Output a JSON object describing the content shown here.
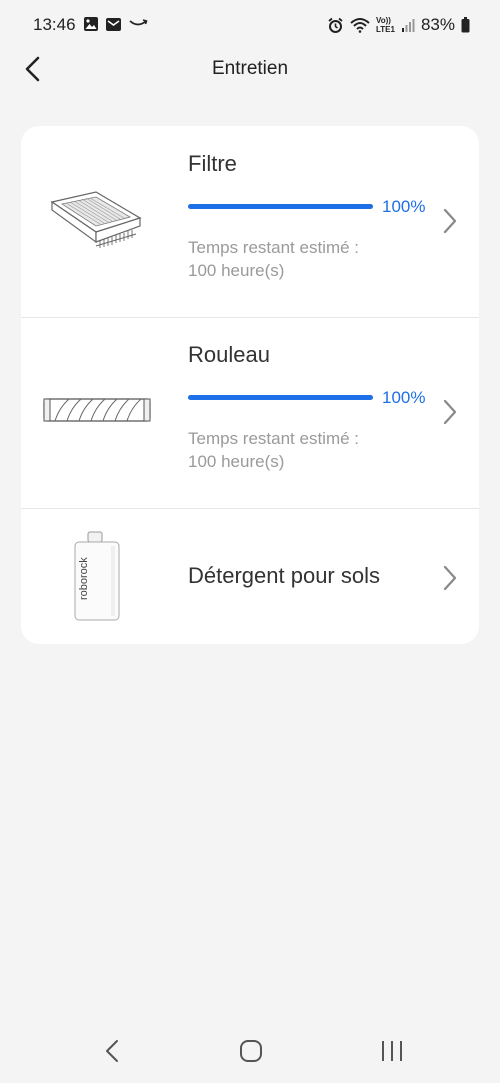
{
  "status_bar": {
    "time": "13:46",
    "battery": "83%",
    "left_icons": [
      "gallery-icon",
      "mail-icon",
      "amazon-icon"
    ],
    "right_icons": [
      "alarm-icon",
      "wifi-icon",
      "volte-icon",
      "signal-icon",
      "battery-icon"
    ],
    "volte_label_top": "Vo))",
    "volte_label_bottom": "LTE1"
  },
  "header": {
    "title": "Entretien"
  },
  "items": [
    {
      "name": "Filtre",
      "progress_percent": 100,
      "percent_label": "100%",
      "remaining_line1": "Temps restant estimé :",
      "remaining_line2": "100 heure(s)",
      "icon": "filter-icon"
    },
    {
      "name": "Rouleau",
      "progress_percent": 100,
      "percent_label": "100%",
      "remaining_line1": "Temps restant estimé :",
      "remaining_line2": "100 heure(s)",
      "icon": "roller-icon"
    },
    {
      "name": "Détergent pour sols",
      "icon": "detergent-bottle-icon",
      "bottle_brand": "roborock"
    }
  ],
  "colors": {
    "accent": "#1e6fe8",
    "background": "#f4f4f4",
    "card": "#ffffff",
    "secondary_text": "#9a9a9a"
  },
  "nav_bar": {
    "buttons": [
      "back-nav-icon",
      "home-nav-icon",
      "recents-nav-icon"
    ]
  }
}
